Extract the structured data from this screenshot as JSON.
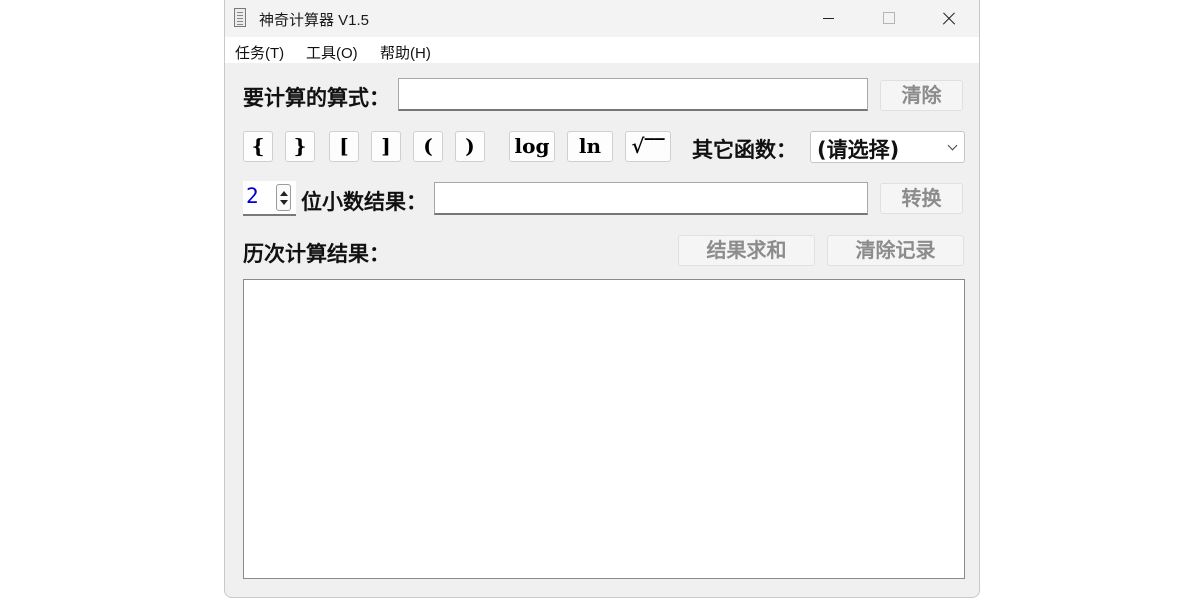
{
  "window": {
    "title": "神奇计算器 V1.5"
  },
  "menu": [
    "任务(T)",
    "工具(O)",
    "帮助(H)"
  ],
  "expression": {
    "label": "要计算的算式：",
    "value": "",
    "clear_label": "清除"
  },
  "keys": [
    "{",
    "}",
    "[",
    "]",
    "(",
    ")",
    "log",
    "ln",
    "√‾‾"
  ],
  "functions": {
    "label": "其它函数：",
    "selected": "(请选择)"
  },
  "decimals": {
    "value": "2",
    "label": "位小数结果：",
    "result": "",
    "convert_label": "转换"
  },
  "history": {
    "label": "历次计算结果：",
    "sum_label": "结果求和",
    "clear_label": "清除记录"
  }
}
